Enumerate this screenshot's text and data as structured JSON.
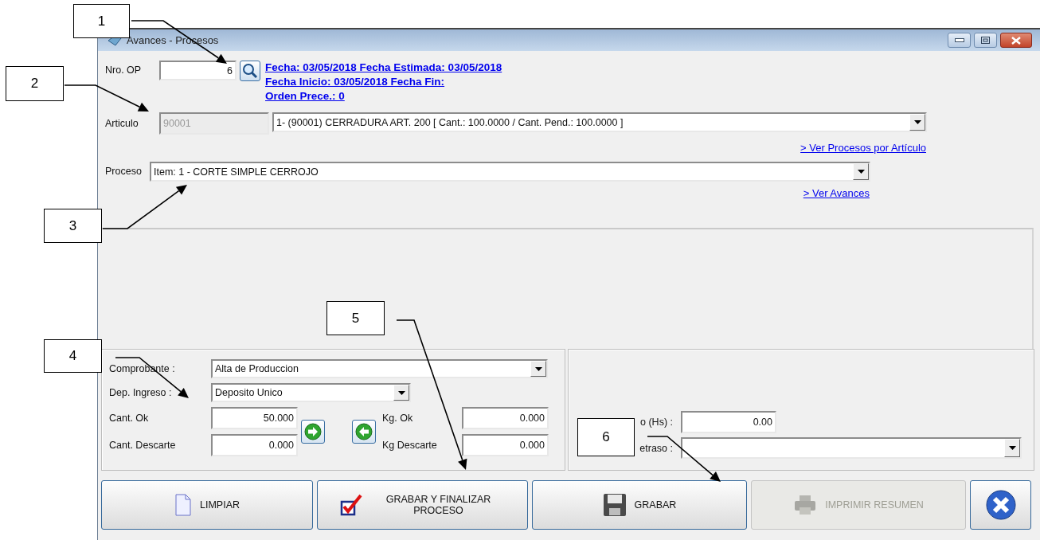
{
  "window": {
    "title": "Avances - Procesos"
  },
  "nro_op": {
    "label": "Nro. OP",
    "value": "6"
  },
  "info_links": [
    "Fecha: 03/05/2018 Fecha Estimada: 03/05/2018",
    "Fecha Inicio: 03/05/2018 Fecha Fin:",
    "Orden Prece.: 0"
  ],
  "articulo": {
    "label": "Articulo",
    "code": "90001",
    "code_disabled": true,
    "selection": "1- (90001) CERRADURA ART. 200 [ Cant.: 100.0000 / Cant. Pend.: 100.0000 ]",
    "link": "> Ver Procesos por Artículo"
  },
  "proceso": {
    "label": "Proceso",
    "selection": "Item: 1 - CORTE SIMPLE CERROJO",
    "link": "> Ver Avances"
  },
  "production": {
    "comprobante": {
      "label": "Comprobante :",
      "selection": "Alta de Produccion"
    },
    "deposito": {
      "label": "Dep. Ingreso :",
      "selection": "Deposito Unico"
    },
    "cant_ok": {
      "label": "Cant. Ok",
      "value": "50.000"
    },
    "cant_descarte": {
      "label": "Cant. Descarte",
      "value": "0.000"
    },
    "kg_ok": {
      "label": "Kg. Ok",
      "value": "0.000"
    },
    "kg_descarte": {
      "label": "Kg Descarte",
      "value": "0.000"
    }
  },
  "time": {
    "hours": {
      "label": "o (Hs) :",
      "value": "0.00"
    },
    "delay": {
      "label": "etraso :"
    }
  },
  "buttons": [
    {
      "label": "LIMPIAR",
      "disabled": false
    },
    {
      "label": "GRABAR Y FINALIZAR PROCESO",
      "disabled": false
    },
    {
      "label": "GRABAR",
      "disabled": false
    },
    {
      "label": "IMPRIMIR RESUMEN",
      "disabled": true
    }
  ],
  "callouts": [
    "1",
    "2",
    "3",
    "4",
    "5",
    "6"
  ]
}
